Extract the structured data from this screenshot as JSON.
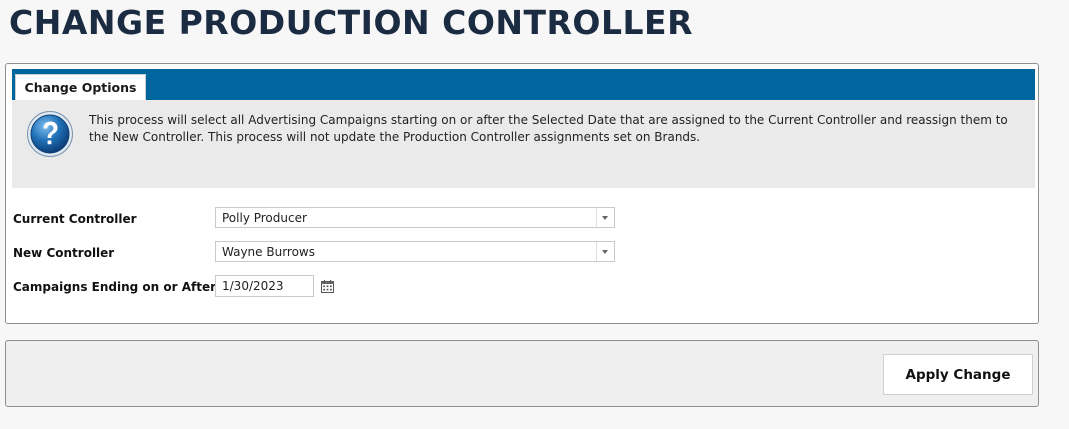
{
  "page": {
    "title": "CHANGE PRODUCTION CONTROLLER"
  },
  "tabs": [
    {
      "label": "Change Options",
      "active": true
    }
  ],
  "info": {
    "icon": "help-question-icon",
    "text": "This process will select all Advertising Campaigns starting on or after the Selected Date that are assigned to the Current Controller and reassign them to the New Controller. This process will not update the Production Controller assignments set on Brands."
  },
  "form": {
    "current_controller": {
      "label": "Current Controller",
      "value": "Polly Producer"
    },
    "new_controller": {
      "label": "New Controller",
      "value": "Wayne Burrows"
    },
    "campaigns_ending": {
      "label": "Campaigns Ending on or After",
      "value": "1/30/2023",
      "icon": "calendar-icon"
    }
  },
  "actions": {
    "apply_label": "Apply Change"
  },
  "colors": {
    "title": "#1b2b42",
    "tab_strip": "#00679e",
    "info_background": "#eaeaea",
    "help_icon": "#1f6fb5"
  }
}
